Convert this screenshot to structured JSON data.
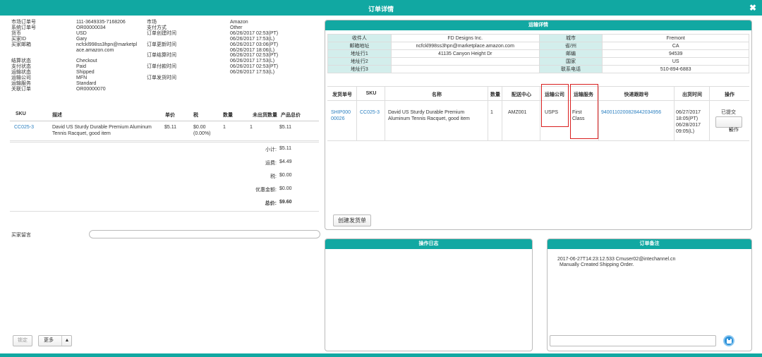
{
  "window": {
    "title": "订单详情",
    "close_icon": "close-icon"
  },
  "order_info_left": [
    {
      "label": "市场订单号",
      "value": "111-3649335-7168206"
    },
    {
      "label": "系统订单号",
      "value": "OR00000034"
    },
    {
      "label": "货币",
      "value": "USD"
    },
    {
      "label": "买家ID",
      "value": "Gary"
    },
    {
      "label": "买家邮箱",
      "value": "ncfckl998ss3hpn@marketpl"
    },
    {
      "label": "",
      "value": "ace.amazon.com"
    },
    {
      "label": "",
      "value": ""
    },
    {
      "label": "结算状态",
      "value": "Checkout"
    },
    {
      "label": "支付状态",
      "value": "Paid"
    },
    {
      "label": "运输状态",
      "value": "Shipped"
    },
    {
      "label": "运输公司",
      "value": "MFN"
    },
    {
      "label": "运输服务",
      "value": "Standard"
    },
    {
      "label": "关联订单",
      "value": "OR00000070"
    }
  ],
  "order_info_right": [
    {
      "label": "市场",
      "value": "Amazon"
    },
    {
      "label": "支付方式",
      "value": "Other"
    },
    {
      "label": "订单创建时间",
      "value": "06/26/2017 02:53(PT)"
    },
    {
      "label": "",
      "value": "06/26/2017 17:53(L)"
    },
    {
      "label": "订单更新时间",
      "value": "06/26/2017 03:06(PT)"
    },
    {
      "label": "",
      "value": "06/26/2017 18:06(L)"
    },
    {
      "label": "订单结算时间",
      "value": "06/26/2017 02:53(PT)"
    },
    {
      "label": "",
      "value": "06/26/2017 17:53(L)"
    },
    {
      "label": "订单付款时间",
      "value": "06/26/2017 02:53(PT)"
    },
    {
      "label": "",
      "value": "06/26/2017 17:53(L)"
    },
    {
      "label": "订单发货时间",
      "value": ""
    }
  ],
  "items": {
    "headers": {
      "sku": "SKU",
      "desc": "描述",
      "price": "单价",
      "tax": "税",
      "qty": "数量",
      "unshipped": "未出货数量",
      "total": "产品总价"
    },
    "rows": [
      {
        "sku": "CC025-3",
        "desc1": "David US Sturdy Durable Premium Aluminum",
        "desc2": "Tennis Racquet, good item",
        "price": "$5.11",
        "tax1": "$0.00",
        "tax2": "(0.00%)",
        "qty": "1",
        "unshipped": "1",
        "total": "$5.11"
      }
    ]
  },
  "totals": [
    {
      "label": "小计:",
      "value": "$5.11"
    },
    {
      "label": "运费:",
      "value": "$4.49"
    },
    {
      "label": "税:",
      "value": "$0.00"
    },
    {
      "label": "优惠金额:",
      "value": "$0.00"
    },
    {
      "label": "总价:",
      "value": "$9.60"
    }
  ],
  "buyer_message_label": "买家留言",
  "bottom_buttons": {
    "lock": "锁定",
    "more": "更多"
  },
  "shipping": {
    "title": "运输详情",
    "address": [
      [
        "收件人",
        "FD Designs Inc.",
        "城市",
        "Fremont"
      ],
      [
        "邮箱地址",
        "ncfckl998ss3hpn@marketplace.amazon.com",
        "省/州",
        "CA"
      ],
      [
        "地址行1",
        "41135 Canyon Height Dr",
        "邮编",
        "94539"
      ],
      [
        "地址行2",
        "",
        "国家",
        "US"
      ],
      [
        "地址行3",
        "",
        "联系电话",
        "510-894-6883"
      ]
    ],
    "headers": {
      "no": "发货单号",
      "sku": "SKU",
      "name": "名称",
      "qty": "数量",
      "fc": "配送中心",
      "carrier": "运输公司",
      "service": "运输服务",
      "tracking": "快递跟踪号",
      "time": "出货时间",
      "op": "操作"
    },
    "row": {
      "no1": "SHIP000",
      "no2": "00026",
      "sku": "CC025-3",
      "name1": "David US Sturdy Durable Premium",
      "name2": "Aluminum Tennis Racquet, good item",
      "qty": "1",
      "fc": "AMZ001",
      "carrier": "USPS",
      "service1": "First",
      "service2": "Class",
      "tracking": "9400110200828442034956",
      "t1": "06/27/2017",
      "t2": "18:05(PT)",
      "t3": "06/28/2017",
      "t4": "09:05(L)",
      "status": "已提交",
      "op_button": "操作"
    },
    "create_button": "创建发货单"
  },
  "log_panel": {
    "title": "操作日志"
  },
  "notes_panel": {
    "title": "订单备注",
    "entry_meta": "2017-06-27T14:23:12.533  Cmuser02@intechannel.cn",
    "entry_text": "Manually Created Shipping Order."
  },
  "colors": {
    "accent": "#11a8a2",
    "link": "#2a7fc0",
    "highlight": "#d91e1e"
  }
}
